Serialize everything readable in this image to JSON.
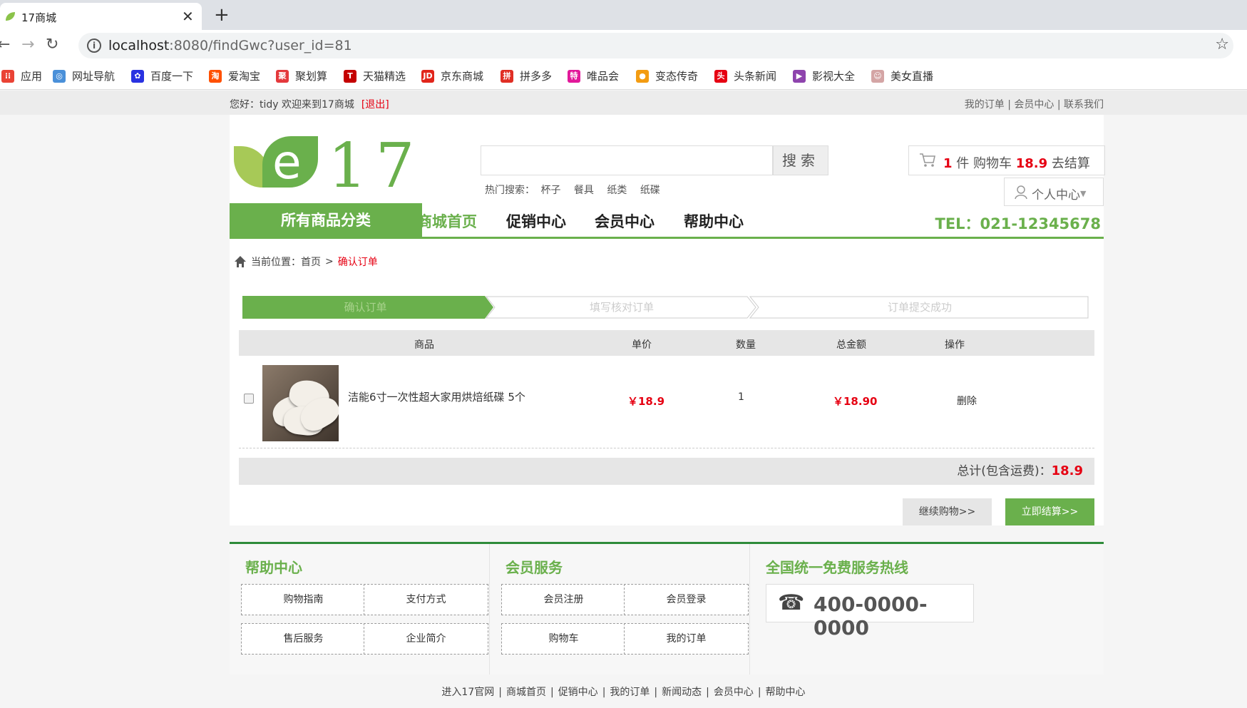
{
  "browser": {
    "tab_title": "17商城",
    "url_host": "localhost",
    "url_rest": ":8080/findGwc?user_id=81",
    "bookmarks": [
      {
        "label": "应用",
        "icon": "apps-grid-icon",
        "color": "#ea4335"
      },
      {
        "label": "网址导航",
        "icon": "globe-icon",
        "color": "#4a90d9"
      },
      {
        "label": "百度一下",
        "icon": "baidu-paw-icon",
        "color": "#2932e1"
      },
      {
        "label": "爱淘宝",
        "icon": "taobao-icon",
        "color": "#ff5000"
      },
      {
        "label": "聚划算",
        "icon": "juhuasuan-icon",
        "color": "#e4393c"
      },
      {
        "label": "天猫精选",
        "icon": "tmall-icon",
        "color": "#c40000"
      },
      {
        "label": "京东商城",
        "icon": "jd-icon",
        "color": "#e1251b"
      },
      {
        "label": "拼多多",
        "icon": "pinduoduo-icon",
        "color": "#e02e24"
      },
      {
        "label": "唯品会",
        "icon": "vip-icon",
        "color": "#e2189a"
      },
      {
        "label": "变态传奇",
        "icon": "game-icon",
        "color": "#f39c12"
      },
      {
        "label": "头条新闻",
        "icon": "toutiao-icon",
        "color": "#e60012"
      },
      {
        "label": "影视大全",
        "icon": "video-play-icon",
        "color": "#8e44ad"
      },
      {
        "label": "美女直播",
        "icon": "live-avatar-icon",
        "color": "#d4a5a5"
      }
    ]
  },
  "topbar": {
    "greeting": "您好：tidy 欢迎来到17商城",
    "logout": "[退出]",
    "links": "我的订单 | 会员中心 | 联系我们"
  },
  "header": {
    "logo_text": "17",
    "search_button": "搜索",
    "hot_label": "热门搜索：",
    "hot_terms": [
      "杯子",
      "餐具",
      "纸类",
      "纸碟"
    ],
    "cart_count": "1",
    "cart_unit": "件",
    "cart_label": "购物车",
    "cart_amount": "18.9",
    "cart_checkout": "去结算",
    "personal_center": "个人中心"
  },
  "nav": {
    "all_categories": "所有商品分类",
    "items": [
      "商城首页",
      "促销中心",
      "会员中心",
      "帮助中心"
    ],
    "tel": "TEL：021-12345678"
  },
  "breadcrumb": {
    "prefix": "当前位置：",
    "home": "首页",
    "separator": ">",
    "current": "确认订单"
  },
  "steps": [
    "确认订单",
    "填写核对订单",
    "订单提交成功"
  ],
  "table": {
    "headers": [
      "商品",
      "单价",
      "数量",
      "总金额",
      "操作"
    ],
    "rows": [
      {
        "name": "洁能6寸一次性超大家用烘焙纸碟 5个",
        "price": "￥18.9",
        "qty": "1",
        "total": "￥18.90",
        "action": "删除"
      }
    ]
  },
  "summary": {
    "label": "总计(包含运费)：",
    "amount": "18.9",
    "continue": "继续购物>>",
    "checkout": "立即结算>>"
  },
  "footer": {
    "help_title": "帮助中心",
    "help_items": [
      "购物指南",
      "支付方式",
      "售后服务",
      "企业简介"
    ],
    "member_title": "会员服务",
    "member_items": [
      "会员注册",
      "会员登录",
      "购物车",
      "我的订单"
    ],
    "hotline_title": "全国统一免费服务热线",
    "hotline": "400-0000-0000"
  },
  "bottom_links": [
    "进入17官网",
    "商城首页",
    "促销中心",
    "我的订单",
    "新闻动态",
    "会员中心",
    "帮助中心"
  ],
  "colors": {
    "brand_green": "#6ab04c",
    "price_red": "#e60012"
  }
}
